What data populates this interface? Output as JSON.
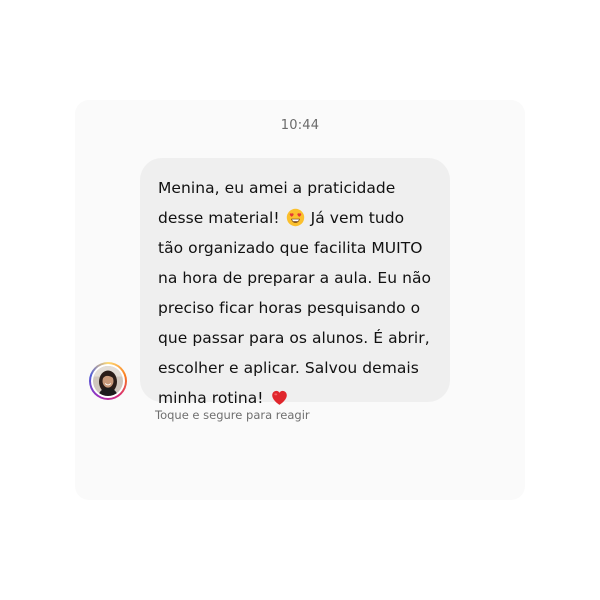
{
  "chat": {
    "timestamp": "10:44",
    "message": {
      "segment_1": "Menina, eu amei a praticidade desse material!",
      "emoji_1": "heart-eyes-emoji",
      "segment_2": "Já vem tudo tão organizado que facilita MUITO na hora de preparar a aula. Eu não preciso ficar horas pesquisando o que passar para os alunos. É abrir, escolher e aplicar. Salvou demais minha rotina!",
      "emoji_2": "red-heart-emoji"
    },
    "reaction_hint": "Toque e segure para reagir",
    "avatar": "user-avatar"
  },
  "colors": {
    "bubble_background": "#efefef",
    "card_background": "#fafafa",
    "text": "#111111",
    "muted_text": "#6b6b6b",
    "heart": "#e0262c",
    "emoji_face": "#fbc02d"
  }
}
